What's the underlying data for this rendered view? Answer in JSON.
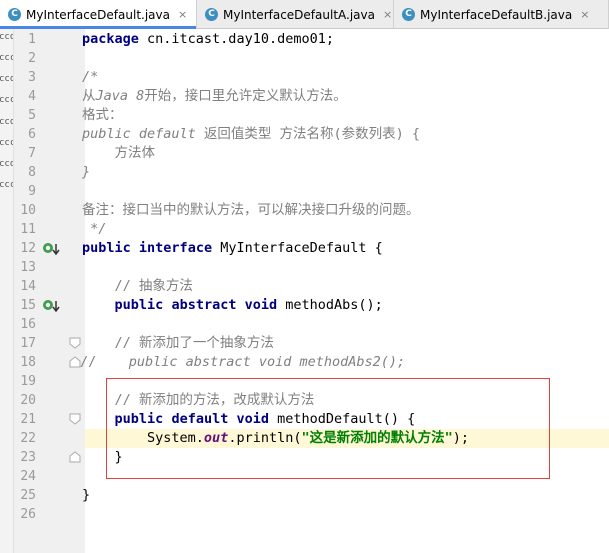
{
  "tabs": [
    {
      "label": "MyInterfaceDefault.java",
      "close": "×"
    },
    {
      "label": "MyInterfaceDefaultA.java",
      "close": "×"
    },
    {
      "label": "MyInterfaceDefaultB.java",
      "close": "×"
    }
  ],
  "tab_icon_letter": "C",
  "left_strip": [
    "cco",
    "ccc",
    "cco",
    "ccc",
    "cco",
    "ccc",
    "cco",
    "ccc"
  ],
  "line_numbers": [
    "1",
    "2",
    "3",
    "4",
    "5",
    "6",
    "7",
    "8",
    "9",
    "10",
    "11",
    "12",
    "13",
    "14",
    "15",
    "16",
    "17",
    "18",
    "19",
    "20",
    "21",
    "22",
    "23",
    "24",
    "25",
    "26"
  ],
  "code": {
    "l1_kw": "package",
    "l1_rest": " cn.itcast.day10.demo01;",
    "l3": "/*",
    "l4_a": "从",
    "l4_b": "Java 8",
    "l4_c": "开始，接口里允许定义默认方法。",
    "l5": "格式：",
    "l6_a": "public default",
    "l6_b": " 返回值类型 方法名称(参数列表) {",
    "l7": "    方法体",
    "l8": "}",
    "l10": "备注：接口当中的默认方法，可以解决接口升级的问题。",
    "l11": " */",
    "l12_kw1": "public",
    "l12_kw2": "interface",
    "l12_rest": " MyInterfaceDefault {",
    "l14": "    // 抽象方法",
    "l15_kw1": "public",
    "l15_kw2": "abstract",
    "l15_kw3": "void",
    "l15_rest": " methodAbs();",
    "l17": "    // 新添加了一个抽象方法",
    "l18_a": "//",
    "l18_b": "    public abstract void methodAbs2();",
    "l20": "    // 新添加的方法，改成默认方法",
    "l21_kw1": "public",
    "l21_kw2": "default",
    "l21_kw3": "void",
    "l21_rest": " methodDefault() {",
    "l22_a": "        System.",
    "l22_b": "out",
    "l22_c": ".println(",
    "l22_d": "\"这是新添加的默认方法\"",
    "l22_e": ");",
    "l23": "    }",
    "l25": "}"
  },
  "colors": {
    "keyword": "#000080",
    "comment": "#808080",
    "string": "#008000",
    "static_field": "#660e7a",
    "active_tab_underline": "#4a86e8",
    "highlight_box": "#e54040",
    "current_line": "#fff8d6"
  },
  "gutter_icons": {
    "line12": "implemented-interface-icon",
    "line15": "implemented-method-icon",
    "line22": "intention-bulb-icon"
  }
}
